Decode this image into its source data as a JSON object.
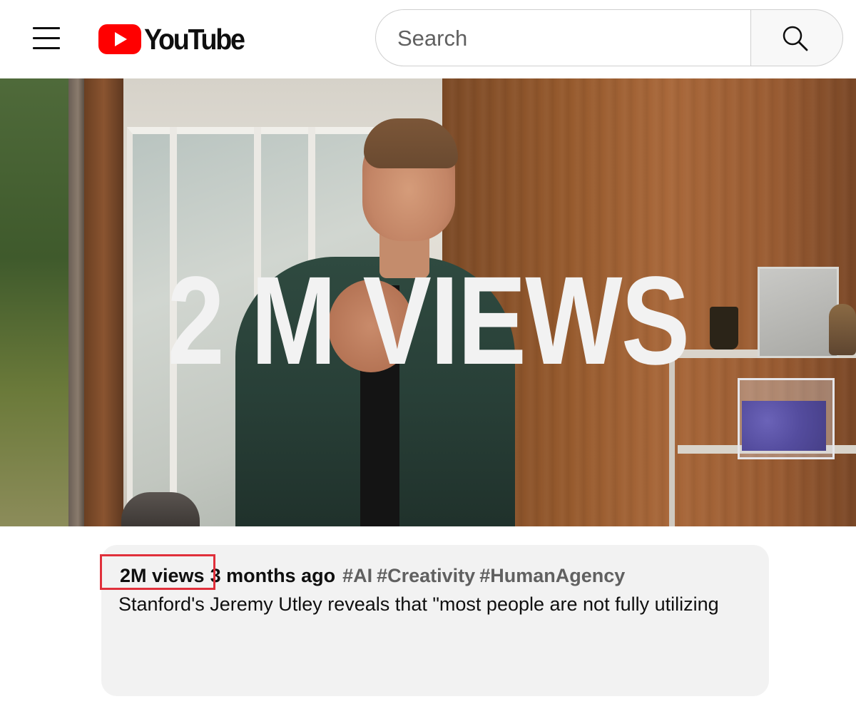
{
  "header": {
    "logo_text": "YouTube",
    "search_placeholder": "Search",
    "icons": {
      "menu": "hamburger-menu-icon",
      "logo": "youtube-play-icon",
      "search": "search-icon"
    },
    "brand_color": "#ff0000"
  },
  "video": {
    "thumbnail_overlay_text": "2 M VIEWS"
  },
  "description": {
    "views": "2M views",
    "date": "3 months ago",
    "hashtags": [
      "#AI",
      "#Creativity",
      "#HumanAgency"
    ],
    "text": "Stanford's Jeremy Utley reveals that \"most people are not fully utilizing",
    "highlight_color": "#e0303b"
  }
}
